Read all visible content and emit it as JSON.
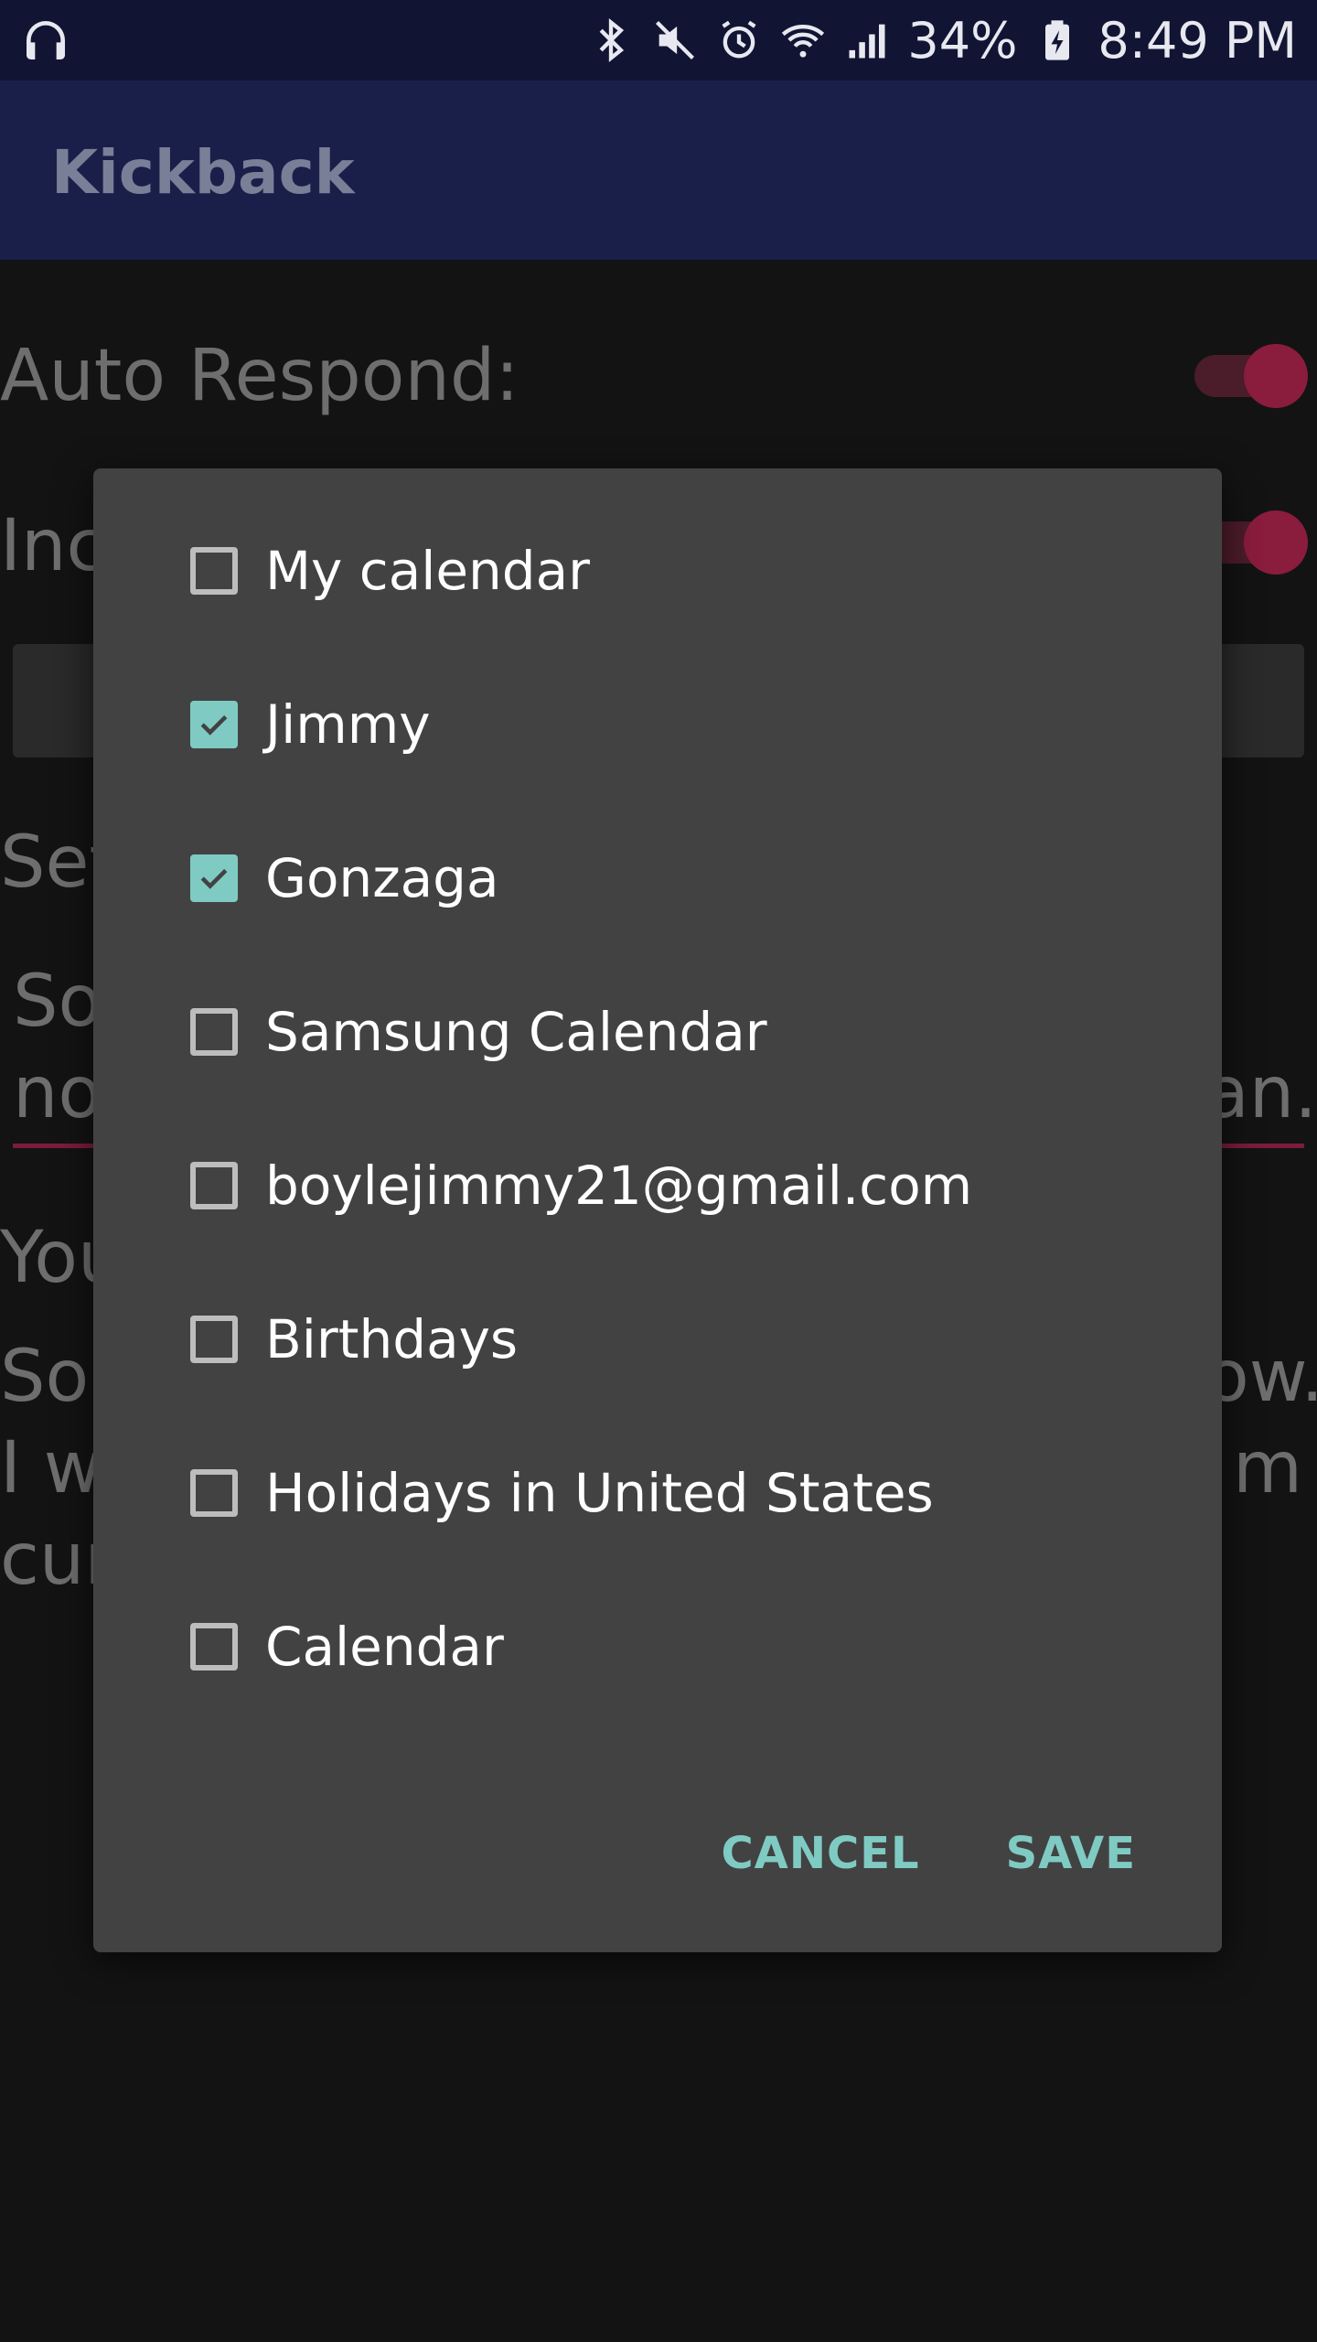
{
  "status_bar": {
    "battery": "34%",
    "time": "8:49 PM",
    "icons": [
      "headphones-icon",
      "bluetooth-icon",
      "mute-icon",
      "alarm-icon",
      "wifi-icon",
      "signal-icon",
      "battery-charging-icon"
    ]
  },
  "app_bar": {
    "title": "Kickback"
  },
  "background": {
    "auto_respond_label": "Auto Respond:",
    "row2_label": "Inc",
    "section_label": "Set",
    "message_line1_start": "So",
    "message_line2_start": "no",
    "message_line2_end": "an.",
    "you_label": "You",
    "preview_line1_start": "So",
    "preview_line1_end": "ow.",
    "preview_line2_start": "I w",
    "preview_line2_end": "m",
    "preview_line3_start": "cur"
  },
  "dialog": {
    "items": [
      {
        "label": "My calendar",
        "checked": false
      },
      {
        "label": "Jimmy",
        "checked": true
      },
      {
        "label": "Gonzaga",
        "checked": true
      },
      {
        "label": "Samsung Calendar",
        "checked": false
      },
      {
        "label": "boylejimmy21@gmail.com",
        "checked": false
      },
      {
        "label": "Birthdays",
        "checked": false
      },
      {
        "label": "Holidays in United States",
        "checked": false
      },
      {
        "label": "Calendar",
        "checked": false
      }
    ],
    "cancel_label": "CANCEL",
    "save_label": "SAVE"
  },
  "colors": {
    "accent": "#7fcbc3",
    "dialog_bg": "#424242",
    "appbar": "#1a1f4a",
    "statusbar": "#111433"
  }
}
